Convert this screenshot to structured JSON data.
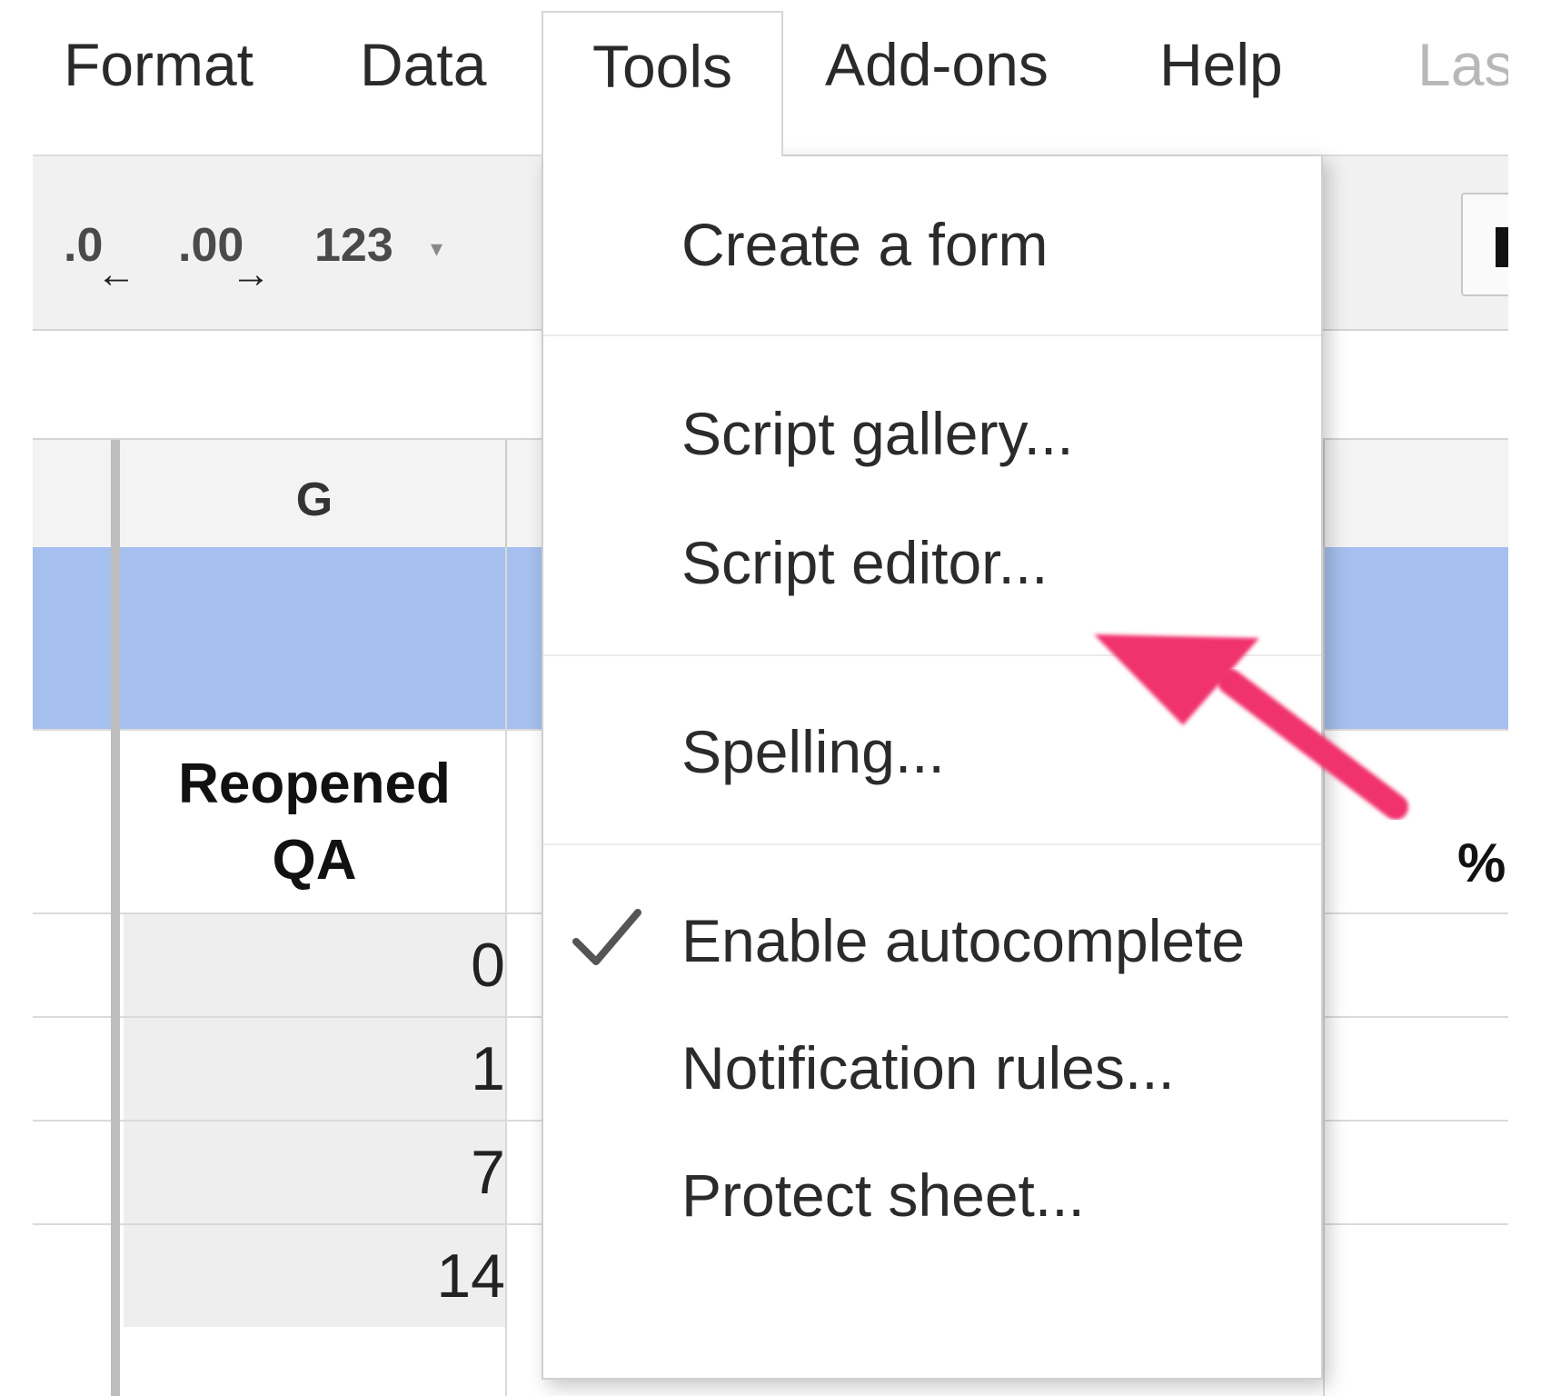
{
  "menubar": {
    "items": [
      "Format",
      "Data",
      "Tools",
      "Add-ons",
      "Help"
    ],
    "last_edit_partial": "Las"
  },
  "toolbar": {
    "decrease_decimal": ".0",
    "increase_decimal": ".00",
    "more_formats": "123",
    "more_formats_caret": "▾",
    "arrow_left": "←",
    "arrow_right": "→"
  },
  "sheet": {
    "column_header": "G",
    "header_line1": "Reopened",
    "header_line2": "QA",
    "right_partial": "%",
    "values": [
      "0",
      "1",
      "7",
      "14"
    ],
    "selected_row_color": "#a5bfee"
  },
  "tools_menu": {
    "items": [
      "Create a form",
      "Script gallery...",
      "Script editor...",
      "Spelling...",
      "Enable autocomplete",
      "Notification rules...",
      "Protect sheet..."
    ],
    "checked_item": "Enable autocomplete"
  },
  "annotation": {
    "arrow_color": "#f0336d",
    "target": "Script editor..."
  }
}
